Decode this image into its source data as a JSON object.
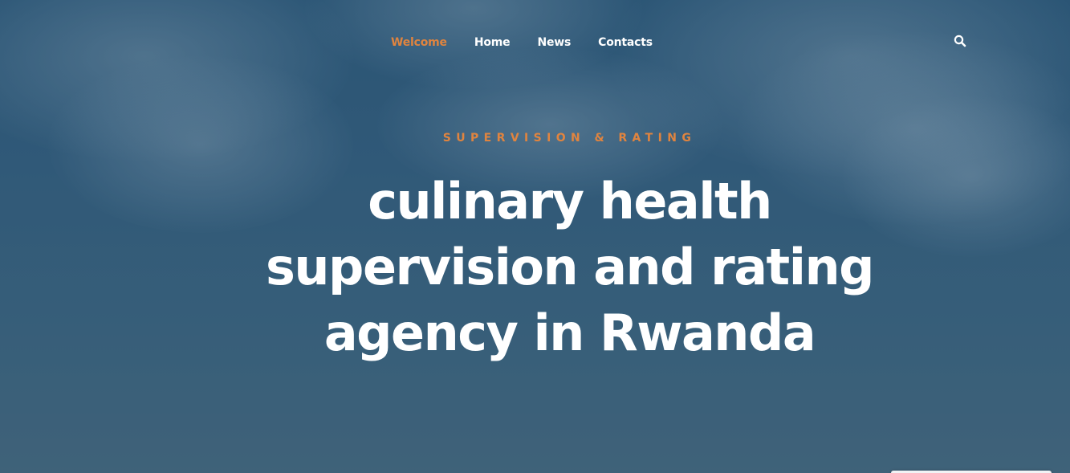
{
  "nav": {
    "items": [
      {
        "label": "Welcome",
        "active": true
      },
      {
        "label": "Home",
        "active": false
      },
      {
        "label": "News",
        "active": false
      },
      {
        "label": "Contacts",
        "active": false
      }
    ],
    "search_icon": "search-icon"
  },
  "hero": {
    "eyebrow": "SUPERVISION & RATING",
    "headline": {
      "line1": "culinary health",
      "line2": "supervision and rating",
      "line3": "agency in Rwanda"
    }
  },
  "colors": {
    "accent": "#e0843f",
    "text": "#ffffff",
    "background": "#365f7f"
  }
}
